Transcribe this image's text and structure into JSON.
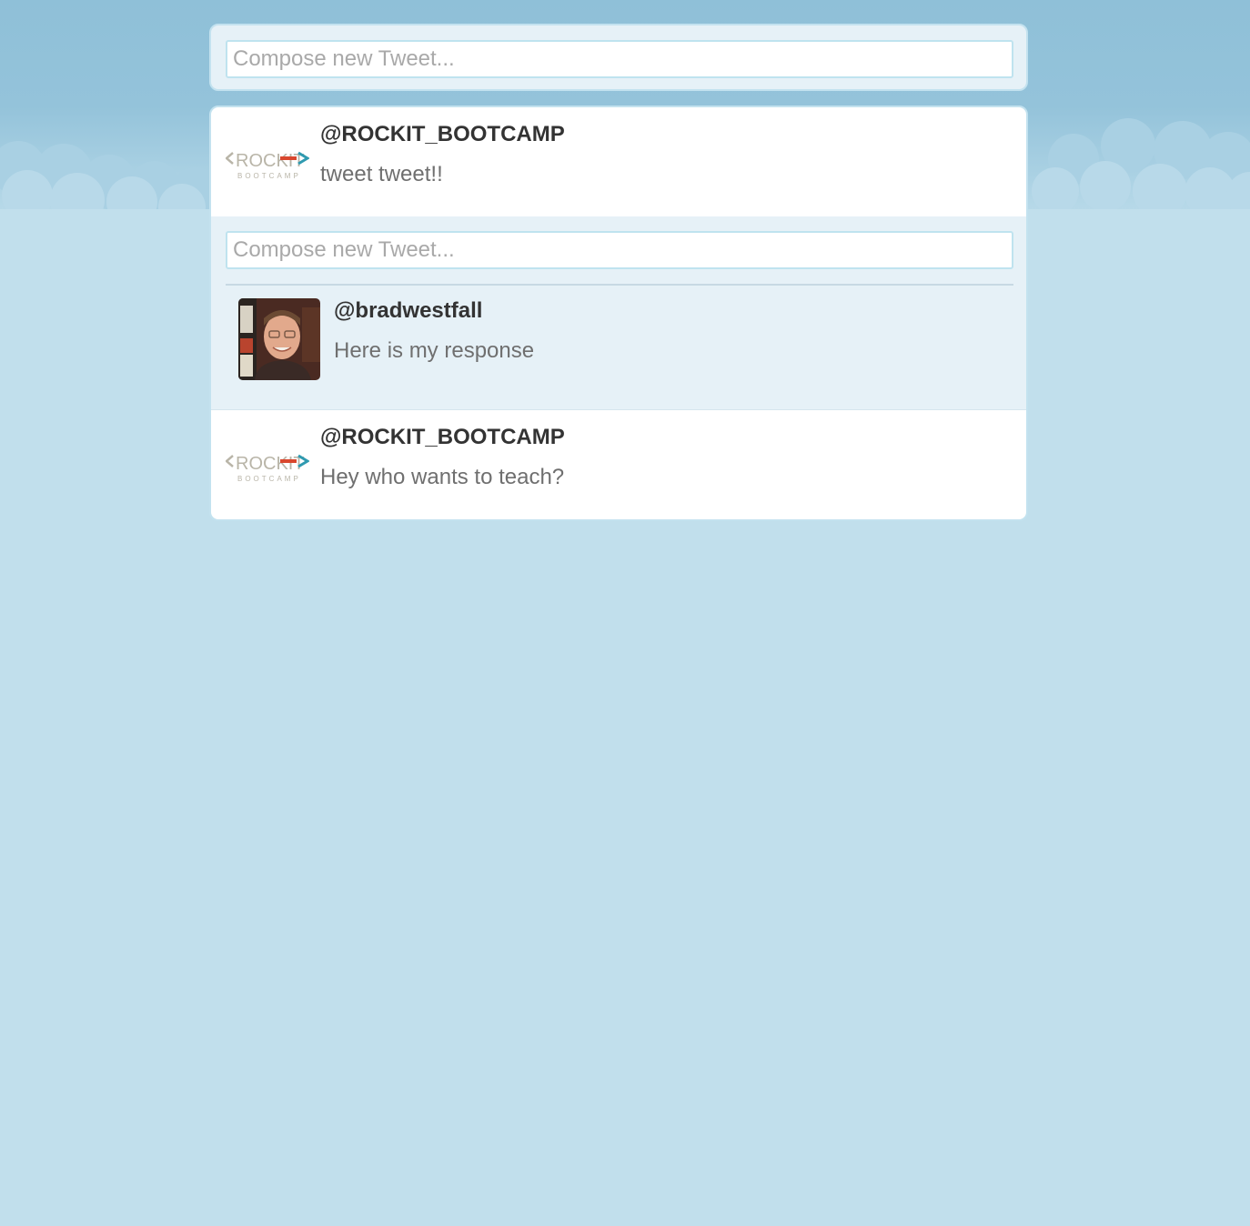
{
  "compose": {
    "placeholder": "Compose new Tweet..."
  },
  "tweets": [
    {
      "handle": "@ROCKIT_BOOTCAMP",
      "text": "tweet tweet!!",
      "avatar": "rockit-bootcamp-logo",
      "logo_word": "ROCKIT",
      "logo_sub": "BOOTCAMP"
    },
    {
      "handle": "@ROCKIT_BOOTCAMP",
      "text": "Hey who wants to teach?",
      "avatar": "rockit-bootcamp-logo",
      "logo_word": "ROCKIT",
      "logo_sub": "BOOTCAMP"
    }
  ],
  "expanded": {
    "reply_placeholder": "Compose new Tweet...",
    "replies": [
      {
        "handle": "@bradwestfall",
        "text": "Here is my response",
        "avatar": "user-photo"
      }
    ]
  },
  "colors": {
    "background": "#c1dfec",
    "sky_top": "#8fc0d8",
    "card_bg": "#e6f1f7",
    "card_border": "#c3e2ef",
    "logo_gray": "#b9b5a8",
    "logo_red": "#d9472e",
    "logo_teal": "#2f9ab0"
  }
}
